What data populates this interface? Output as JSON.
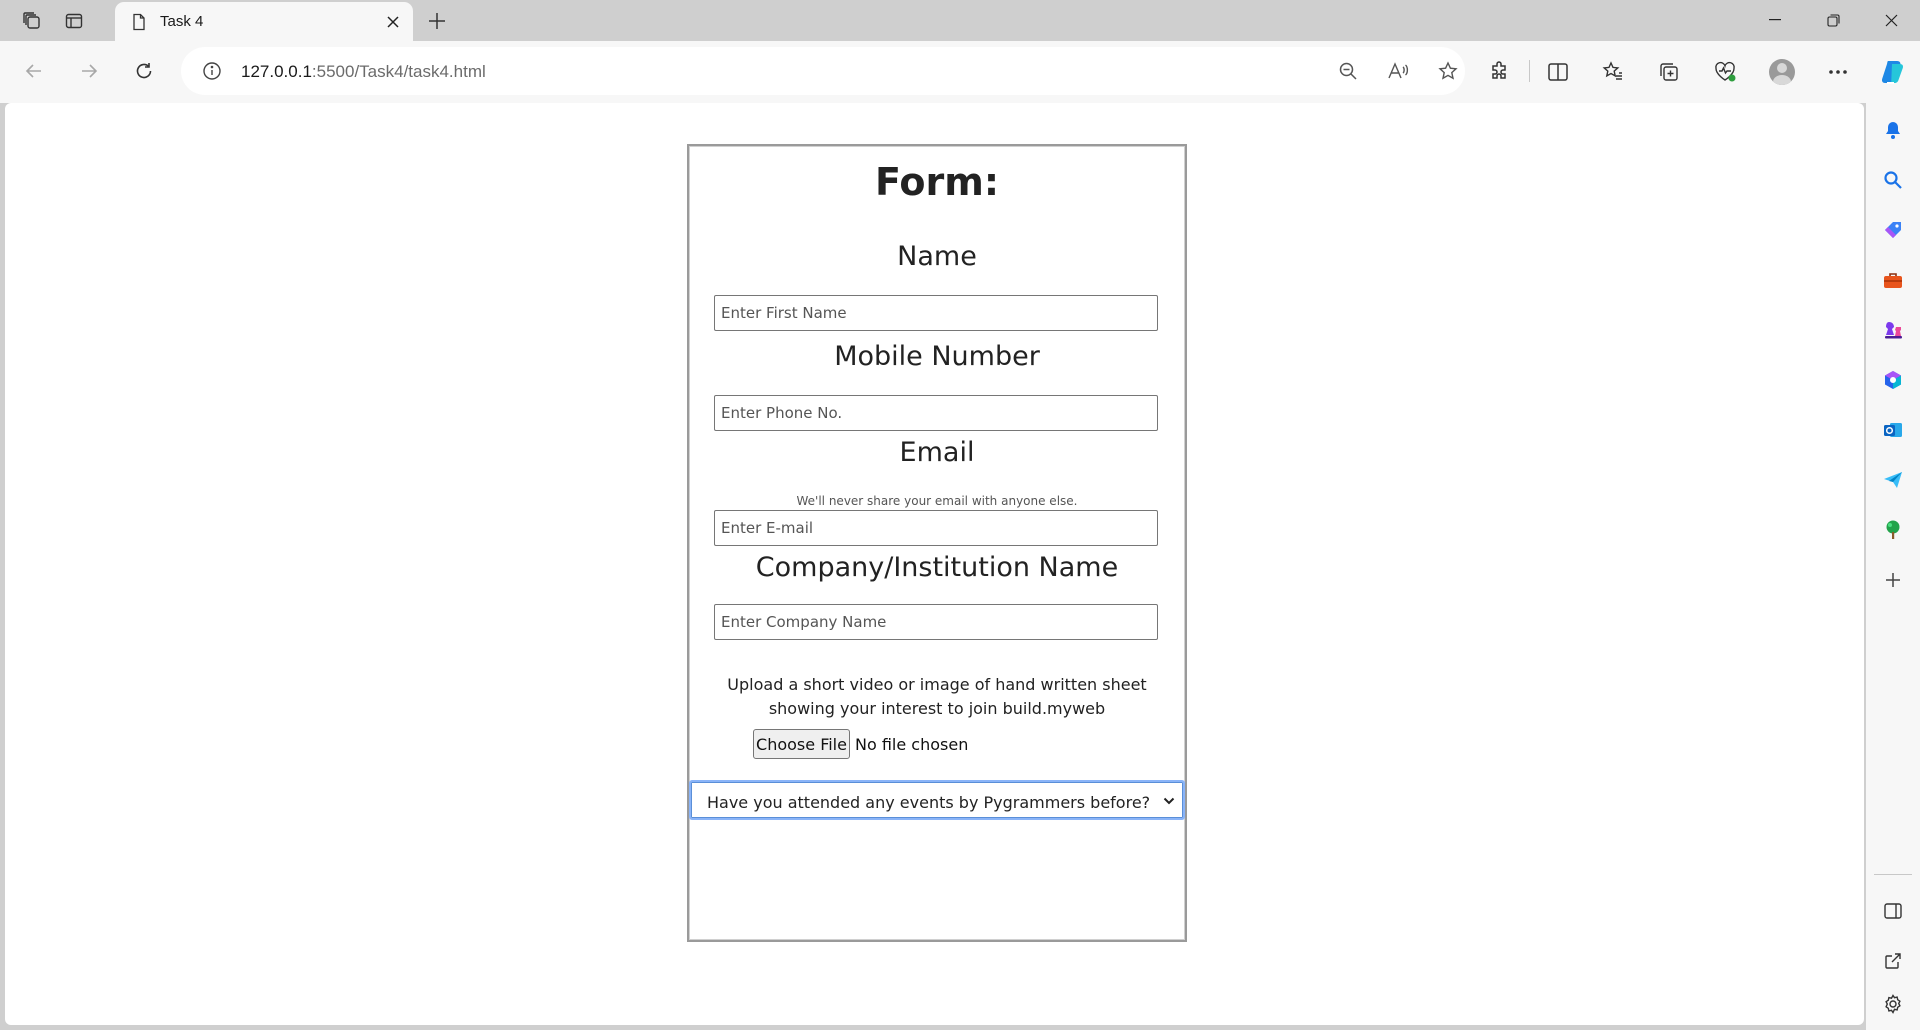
{
  "browser": {
    "tab": {
      "title": "Task 4"
    },
    "address": {
      "host": "127.0.0.1",
      "rest": ":5500/Task4/task4.html"
    }
  },
  "form": {
    "title": "Form:",
    "name": {
      "label": "Name",
      "placeholder": "Enter First Name"
    },
    "mobile": {
      "label": "Mobile Number",
      "placeholder": "Enter Phone No."
    },
    "email": {
      "label": "Email",
      "hint": "We'll never share your email with anyone else.",
      "placeholder": "Enter E-mail"
    },
    "company": {
      "label": "Company/Institution Name",
      "placeholder": "Enter Company Name"
    },
    "upload": {
      "text": "Upload a short video or image of hand written sheet showing your interest to join build.myweb",
      "button_label": "Choose File",
      "status": "No file chosen"
    },
    "events_select": {
      "selected": "Have you attended any events by Pygrammers before?"
    }
  },
  "colors": {
    "accent": "#1a73e8",
    "focus_ring": "#8ab4f8"
  }
}
